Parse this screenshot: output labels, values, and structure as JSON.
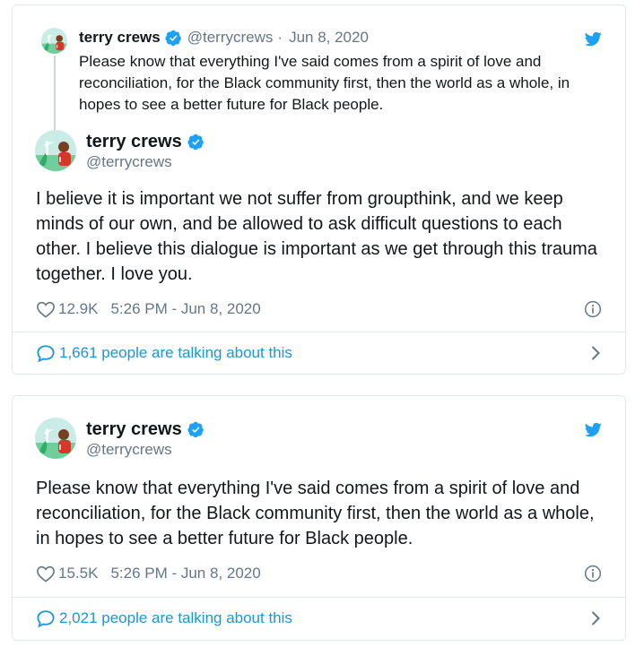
{
  "colors": {
    "accent": "#1da1f2",
    "link": "#1b95e0",
    "muted": "#657786",
    "border": "#e1e8ed",
    "text": "#14171a"
  },
  "icons": {
    "brand": "twitter-bird-icon",
    "verified": "verified-badge-icon",
    "like": "heart-icon",
    "info": "info-icon",
    "replies": "speech-bubble-icon",
    "more": "chevron-right-icon"
  },
  "embed1": {
    "quoted": {
      "name": "terry crews",
      "handle": "@terrycrews",
      "separator": "·",
      "date": "Jun 8, 2020",
      "text": "Please know that everything I've said comes from a spirit of love and reconciliation, for the Black community first, then the world as a whole, in hopes to see a better future for Black people."
    },
    "tweet": {
      "name": "terry crews",
      "handle": "@terrycrews",
      "text": "I believe it is important we not suffer from groupthink, and we keep minds of our own, and be allowed to ask difficult questions to each other. I believe this dialogue is important as we get through this trauma together. I love you.",
      "likes": "12.9K",
      "timestamp": "5:26 PM - Jun 8, 2020",
      "talking": "1,661 people are talking about this"
    }
  },
  "embed2": {
    "tweet": {
      "name": "terry crews",
      "handle": "@terrycrews",
      "text": "Please know that everything I've said comes from a spirit of love and reconciliation, for the Black community first, then the world as a whole, in hopes to see a better future for Black people.",
      "likes": "15.5K",
      "timestamp": "5:26 PM - Jun 8, 2020",
      "talking": "2,021 people are talking about this"
    }
  }
}
